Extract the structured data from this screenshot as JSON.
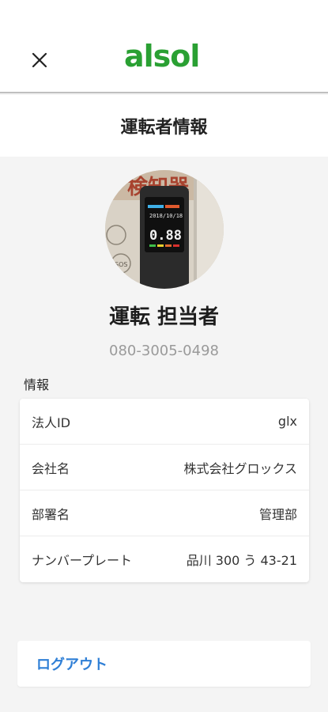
{
  "header": {
    "close_icon": "close-icon",
    "logo_text": "alsol",
    "logo_color": "#2aa033"
  },
  "page": {
    "title": "運転者情報"
  },
  "profile": {
    "avatar_icon": "breathalyzer-photo",
    "name": "運転 担当者",
    "phone": "080-3005-0498",
    "avatar_device_reading": "0.88",
    "avatar_banner_text": "検知器"
  },
  "info": {
    "section_label": "情報",
    "rows": [
      {
        "label": "法人ID",
        "value": "glx"
      },
      {
        "label": "会社名",
        "value": "株式会社グロックス"
      },
      {
        "label": "部署名",
        "value": "管理部"
      },
      {
        "label": "ナンバープレート",
        "value": "品川 300 う 43-21"
      }
    ]
  },
  "logout": {
    "label": "ログアウト",
    "color": "#2f7fd6"
  }
}
